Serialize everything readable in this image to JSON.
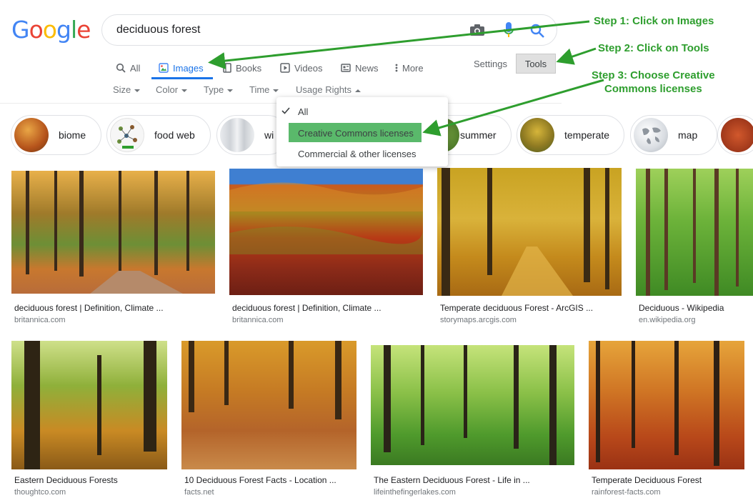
{
  "logo": {
    "letters": [
      "G",
      "o",
      "o",
      "g",
      "l",
      "e"
    ],
    "colors": [
      "#4285f4",
      "#ea4335",
      "#fbbc05",
      "#4285f4",
      "#34a853",
      "#ea4335"
    ]
  },
  "search": {
    "value": "deciduous forest"
  },
  "tabs": [
    {
      "label": "All",
      "icon": "search-icon"
    },
    {
      "label": "Images",
      "icon": "image-icon",
      "active": true
    },
    {
      "label": "Books",
      "icon": "book-icon"
    },
    {
      "label": "Videos",
      "icon": "play-icon"
    },
    {
      "label": "News",
      "icon": "news-icon"
    },
    {
      "label": "More",
      "icon": "more-vert-icon"
    }
  ],
  "settings_label": "Settings",
  "tools_label": "Tools",
  "filters": [
    "Size",
    "Color",
    "Type",
    "Time",
    "Usage Rights"
  ],
  "chips": [
    "biome",
    "food web",
    "wi",
    "summer",
    "temperate",
    "map"
  ],
  "usage_dropdown": {
    "items": [
      "All",
      "Creative Commons licenses",
      "Commercial & other licenses"
    ],
    "checked": "All",
    "highlighted": "Creative Commons licenses"
  },
  "results_row1": [
    {
      "title": "deciduous forest | Definition, Climate ...",
      "domain": "britannica.com"
    },
    {
      "title": "deciduous forest | Definition, Climate ...",
      "domain": "britannica.com"
    },
    {
      "title": "Temperate deciduous Forest - ArcGIS ...",
      "domain": "storymaps.arcgis.com"
    },
    {
      "title": "Deciduous - Wikipedia",
      "domain": "en.wikipedia.org"
    }
  ],
  "results_row2": [
    {
      "title": "Eastern Deciduous Forests",
      "domain": "thoughtco.com"
    },
    {
      "title": "10 Deciduous Forest Facts - Location ...",
      "domain": "facts.net"
    },
    {
      "title": "The Eastern Deciduous Forest - Life in ...",
      "domain": "lifeinthefingerlakes.com"
    },
    {
      "title": "Temperate Deciduous Forest",
      "domain": "rainforest-facts.com"
    }
  ],
  "annotations": {
    "step1": "Step 1: Click on Images",
    "step2": "Step 2: Click on Tools",
    "step3_line1": "Step 3: Choose Creative",
    "step3_line2": "Commons licenses"
  },
  "colors": {
    "accent": "#1a73e8",
    "annotation": "#2e9e2e",
    "highlight": "#5ab96b"
  }
}
